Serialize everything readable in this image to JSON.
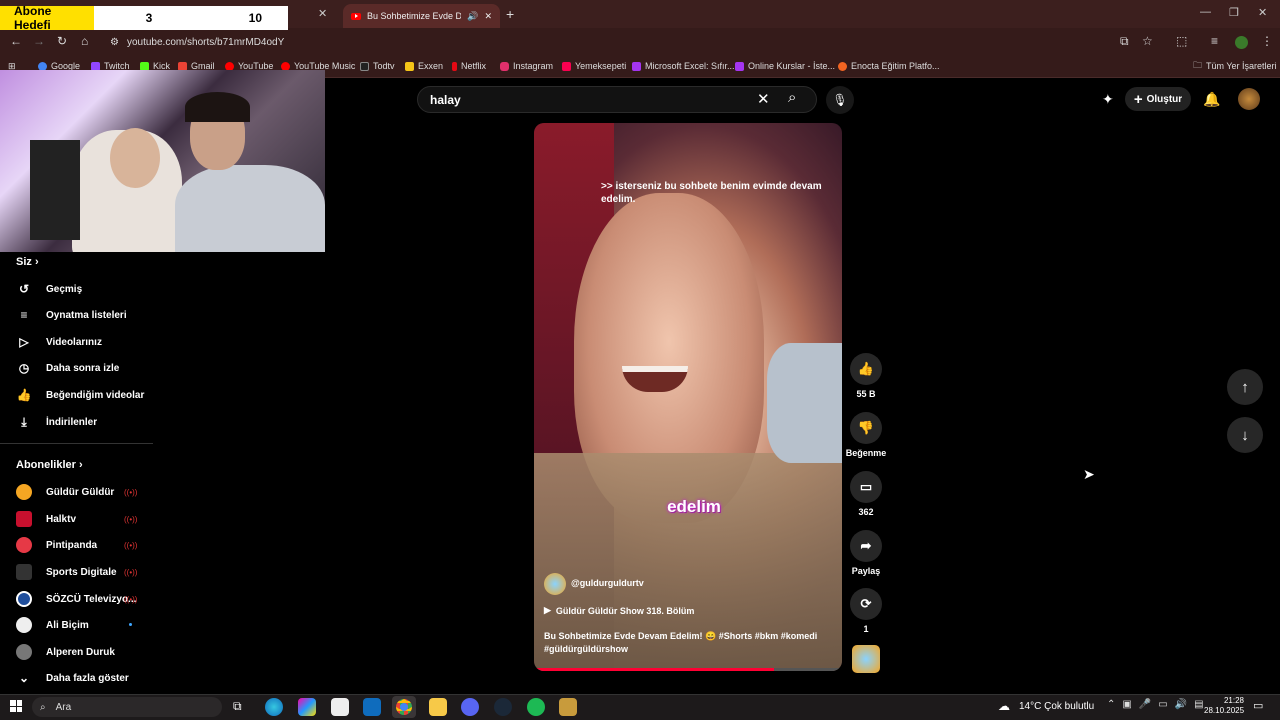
{
  "browser": {
    "active_tab_title": "Bu Sohbetimize Evde Devam",
    "url": "youtube.com/shorts/b71mrMD4odY",
    "bookmarks": [
      "Google",
      "Twitch",
      "Kick",
      "Gmail",
      "YouTube",
      "YouTube Music",
      "Todtv",
      "Exxen",
      "Netflix",
      "Instagram",
      "Yemeksepeti",
      "Microsoft Excel: Sıfır...",
      "Online Kurslar - İste...",
      "Enocta Eğitim Platfo..."
    ],
    "bookmark_colors": [
      "#4285f4",
      "#9146ff",
      "#53fc18",
      "#ea4335",
      "#ff0000",
      "#ff0000",
      "#222",
      "#f5c518",
      "#e50914",
      "#e1306c",
      "#fa0050",
      "#a435f0",
      "#a435f0",
      "#f26522"
    ],
    "all_bookmarks": "Tüm Yer İşaretleri"
  },
  "overlay": {
    "label": "Abone Hedefi",
    "current": "3",
    "target": "10"
  },
  "youtube": {
    "search_value": "halay",
    "create_label": "Oluştur",
    "sidebar": {
      "you_title": "Siz",
      "you_items": [
        {
          "label": "Geçmiş",
          "icon": "history-icon"
        },
        {
          "label": "Oynatma listeleri",
          "icon": "playlist-icon"
        },
        {
          "label": "Videolarınız",
          "icon": "video-icon"
        },
        {
          "label": "Daha sonra izle",
          "icon": "clock-icon"
        },
        {
          "label": "Beğendiğim videolar",
          "icon": "thumbs-up-icon"
        },
        {
          "label": "İndirilenler",
          "icon": "download-icon"
        }
      ],
      "subs_title": "Abonelikler",
      "subs": [
        {
          "label": "Güldür Güldür",
          "color": "#f5a623",
          "live": true
        },
        {
          "label": "Halktv",
          "color": "#c8102e",
          "live": true
        },
        {
          "label": "Pintipanda",
          "color": "#e63946",
          "live": true
        },
        {
          "label": "Sports Digitale",
          "color": "#222",
          "live": true
        },
        {
          "label": "SÖZCÜ Televizyo...",
          "color": "#1f4e9c",
          "live": true
        },
        {
          "label": "Ali Biçim",
          "color": "#eee",
          "live": false
        },
        {
          "label": "Alperen Duruk",
          "color": "#777",
          "live": false
        }
      ],
      "show_more": "Daha fazla göster"
    },
    "short": {
      "caption": ">> isterseniz bu sohbete benim evimde devam edelim.",
      "subtitle_word": "edelim",
      "channel": "@guldurguldurtv",
      "playlist": "Güldür Güldür Show 318. Bölüm",
      "title": "Bu Sohbetimize Evde Devam Edelim! 😄 ",
      "hashtags": "#Shorts #bkm #komedi #güldürgüldürshow"
    },
    "actions": {
      "likes": "55 B",
      "dislike": "Beğenme",
      "comments": "362",
      "share": "Paylaş",
      "remix": "1"
    }
  },
  "taskbar": {
    "search_placeholder": "Ara",
    "weather": "14°C  Çok bulutlu",
    "time": "21:28",
    "date": "28.10.2025"
  }
}
